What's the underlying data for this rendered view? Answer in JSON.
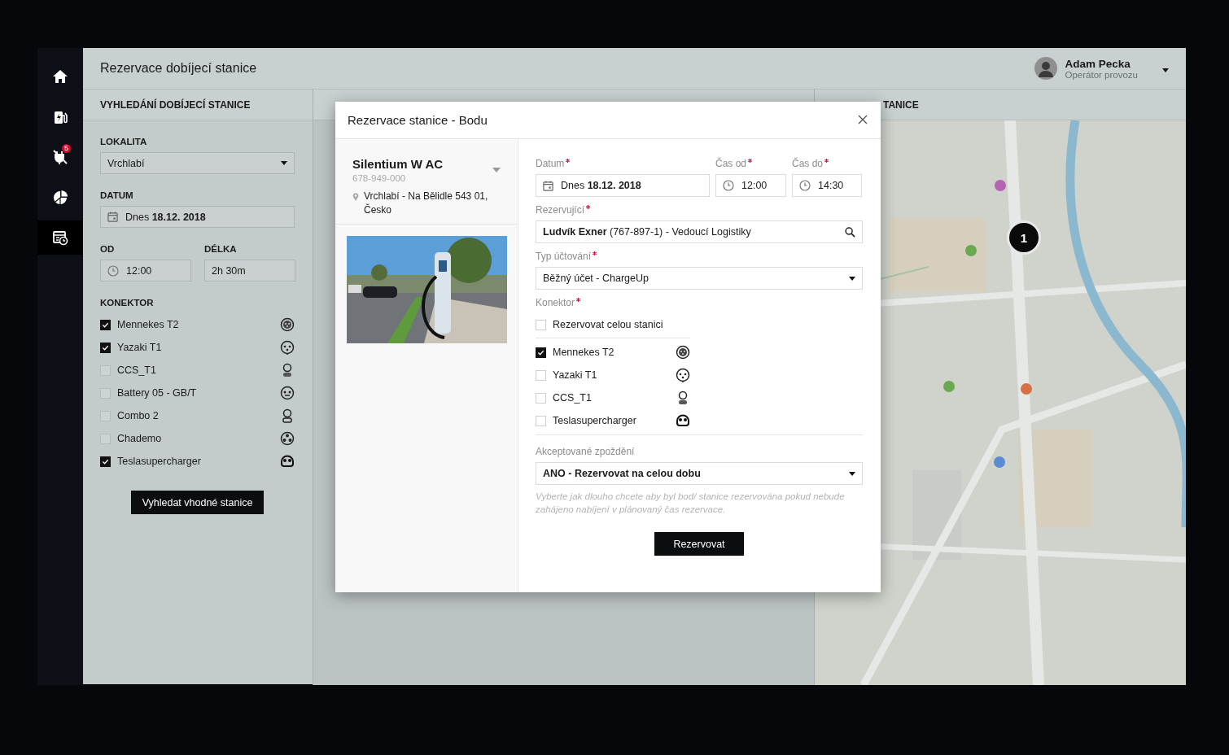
{
  "sidebar": {
    "items": [
      {
        "kind": "home",
        "selected": false
      },
      {
        "kind": "station",
        "selected": false
      },
      {
        "kind": "plug-off",
        "selected": false,
        "badge": "5"
      },
      {
        "kind": "pie",
        "selected": false
      },
      {
        "kind": "schedule",
        "selected": true
      }
    ]
  },
  "header": {
    "title": "Rezervace dobíjecí stanice",
    "user": {
      "name": "Adam Pecka",
      "role": "Operátor provozu"
    }
  },
  "search_panel": {
    "title": "VYHLEDÁNÍ DOBÍJECÍ STANICE",
    "location": {
      "label": "LOKALITA",
      "value": "Vrchlabí"
    },
    "date": {
      "label": "DATUM",
      "value": "Dnes **18.12. 2018**"
    },
    "from": {
      "label": "OD",
      "value": "12:00"
    },
    "duration": {
      "label": "DÉLKA",
      "value": "2h 30m"
    },
    "connectors_label": "KONEKTOR",
    "connectors": [
      {
        "name": "Mennekes T2",
        "checked": true,
        "kind": "type2"
      },
      {
        "name": "Yazaki T1",
        "checked": true,
        "kind": "type1"
      },
      {
        "name": "CCS_T1",
        "checked": false,
        "kind": "ccs1"
      },
      {
        "name": "Battery 05 - GB/T",
        "checked": false,
        "kind": "gbt"
      },
      {
        "name": "Combo 2",
        "checked": false,
        "kind": "ccs2"
      },
      {
        "name": "Chademo",
        "checked": false,
        "kind": "chademo"
      },
      {
        "name": "Teslasupercharger",
        "checked": true,
        "kind": "tesla"
      }
    ],
    "button": "Vyhledat vhodné stanice"
  },
  "map_panel": {
    "title": "TANICE",
    "marker": "1"
  },
  "modal": {
    "title": "Rezervace stanice - Bodu",
    "station": {
      "name": "Silentium W AC",
      "phone": "678-949-000",
      "address": "Vrchlabí - Na Bělidle 543 01, Česko"
    },
    "date": {
      "label": "Datum",
      "required": true,
      "value": "Dnes **18.12. 2018**"
    },
    "time_from": {
      "label": "Čas od",
      "required": true,
      "value": "12:00"
    },
    "time_to": {
      "label": "Čas do",
      "required": true,
      "value": "14:30"
    },
    "booker": {
      "label": "Rezervující",
      "required": true,
      "value": "**Ludvík Exner** (767-897-1) - Vedoucí Logistiky"
    },
    "billing": {
      "label": "Typ účtování",
      "required": true,
      "value": "Běžný účet - ChargeUp"
    },
    "connector_label": "Konektor",
    "connector_required": true,
    "whole_station": {
      "label": "Rezervovat celou stanici",
      "checked": false
    },
    "connectors": [
      {
        "name": "Mennekes T2",
        "checked": true,
        "kind": "type2"
      },
      {
        "name": "Yazaki T1",
        "checked": false,
        "kind": "type1"
      },
      {
        "name": "CCS_T1",
        "checked": false,
        "kind": "ccs1"
      },
      {
        "name": "Teslasupercharger",
        "checked": false,
        "kind": "tesla"
      }
    ],
    "delay": {
      "label": "Akceptované zpoždění",
      "value": "ANO - Rezervovat na celou dobu",
      "hint": "Vyberte jak dlouho chcete aby byl bod/ stanice rezervována pokud nebude zahájeno nabíjení v plánovaný čas rezervace."
    },
    "submit": "Rezervovat"
  }
}
